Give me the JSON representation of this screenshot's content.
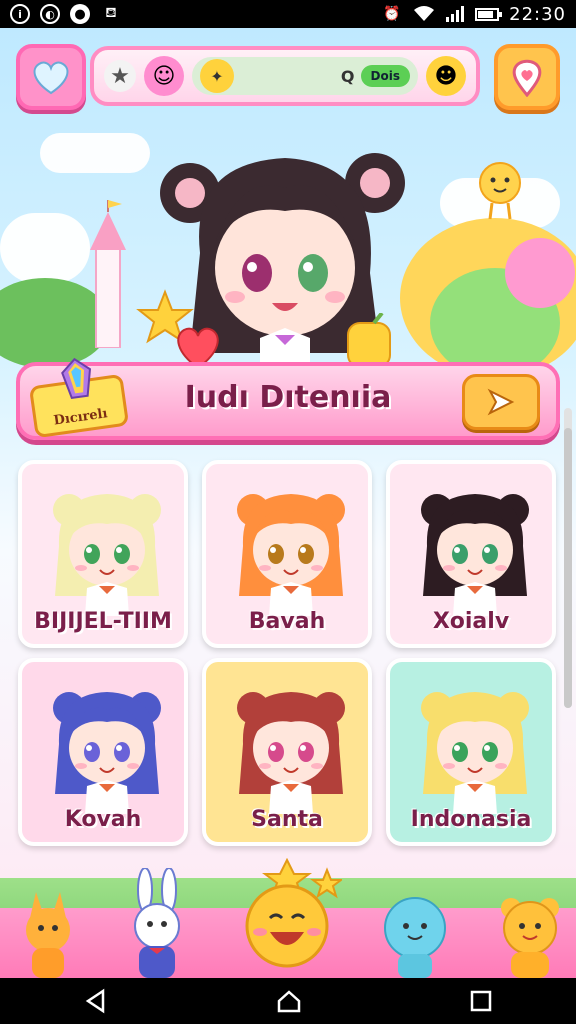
{
  "status_bar": {
    "time": "22:30",
    "battery_level": 0.8,
    "left_icons": [
      "info-icon",
      "sync-icon",
      "chat-icon",
      "game-icon"
    ],
    "right_icons": [
      "alarm-icon",
      "wifi-icon",
      "signal-icon",
      "battery-icon"
    ]
  },
  "topbar": {
    "resources": [
      "star-icon",
      "pink-smiley-icon",
      "yellow-coin-icon"
    ],
    "search_label": "Q",
    "pill_label": "Dois",
    "right_icons": [
      "smiley-icon",
      "map-pin-icon"
    ]
  },
  "banner": {
    "title": "Iudı Dıtenıia",
    "badge_label": "Dıcırelı"
  },
  "cards": [
    {
      "label": "BIJIJEL-TIIM",
      "bg": "#ffe7f1",
      "hair": "#f4eeb0",
      "eyes": "#41a45a"
    },
    {
      "label": "Bavah",
      "bg": "#ffe7f1",
      "hair": "#ff8f3d",
      "eyes": "#b87a1c"
    },
    {
      "label": "Xoialv",
      "bg": "#ffe7f1",
      "hair": "#2d1c22",
      "eyes": "#3a9f6a"
    },
    {
      "label": "Kovah",
      "bg": "#ffd9ea",
      "hair": "#4e59c9",
      "eyes": "#6a62d8"
    },
    {
      "label": "Santa",
      "bg": "#ffe493",
      "hair": "#b2403a",
      "eyes": "#d64a8c"
    },
    {
      "label": "Indonasia",
      "bg": "#b7f0e2",
      "hair": "#f8de6c",
      "eyes": "#3aa35a"
    }
  ],
  "bottom_mascots": [
    "fox-icon",
    "bunny-icon",
    "sun-face-icon",
    "slime-icon",
    "bear-icon"
  ],
  "nav": [
    "back-icon",
    "home-icon",
    "recents-icon"
  ],
  "colors": {
    "accent_pink": "#ff6fb5",
    "accent_yellow": "#ffc44d"
  }
}
